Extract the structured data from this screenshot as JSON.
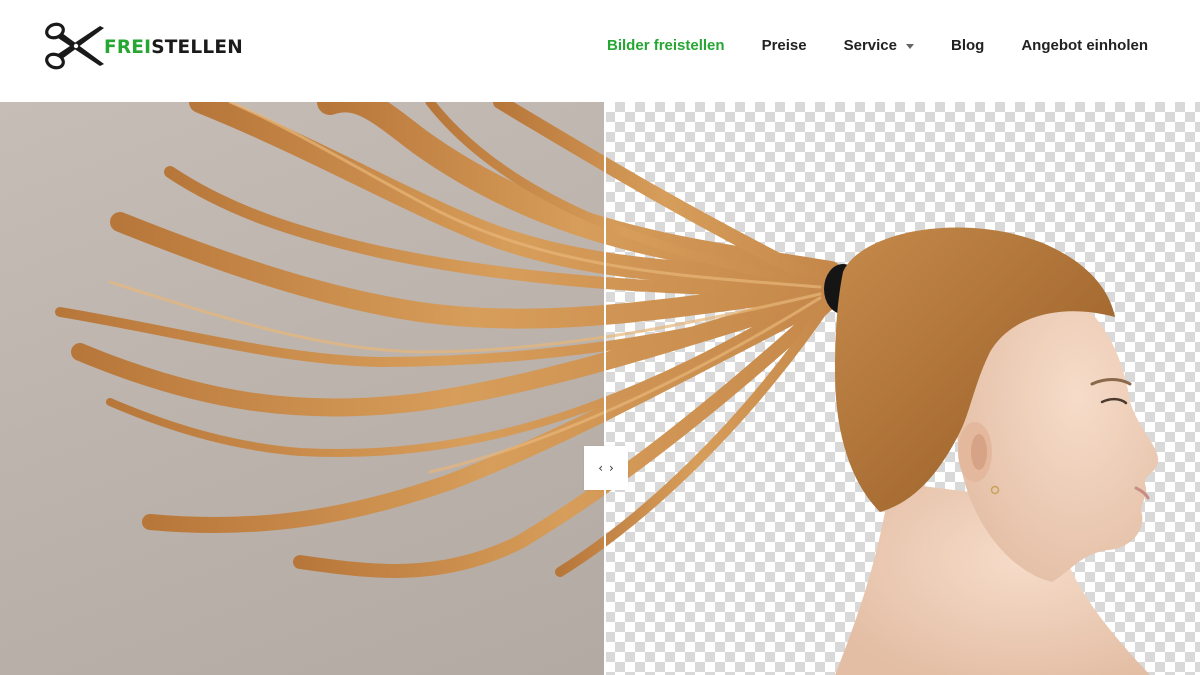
{
  "logo": {
    "brand_accent": "FREI",
    "brand_rest": "STELLEN",
    "icon": "scissors-icon"
  },
  "nav": {
    "items": [
      {
        "label": "Bilder freistellen",
        "active": true
      },
      {
        "label": "Preise"
      },
      {
        "label": "Service",
        "has_dropdown": true
      },
      {
        "label": "Blog"
      },
      {
        "label": "Angebot einholen"
      }
    ]
  },
  "comparison": {
    "before_background": "neutral-gray-studio",
    "after_background": "transparent-checkerboard",
    "handle": {
      "left_glyph": "‹",
      "right_glyph": "›"
    }
  },
  "colors": {
    "accent": "#26a632",
    "text": "#222222",
    "hair": "#c98a4a",
    "skin": "#efd2bd"
  }
}
